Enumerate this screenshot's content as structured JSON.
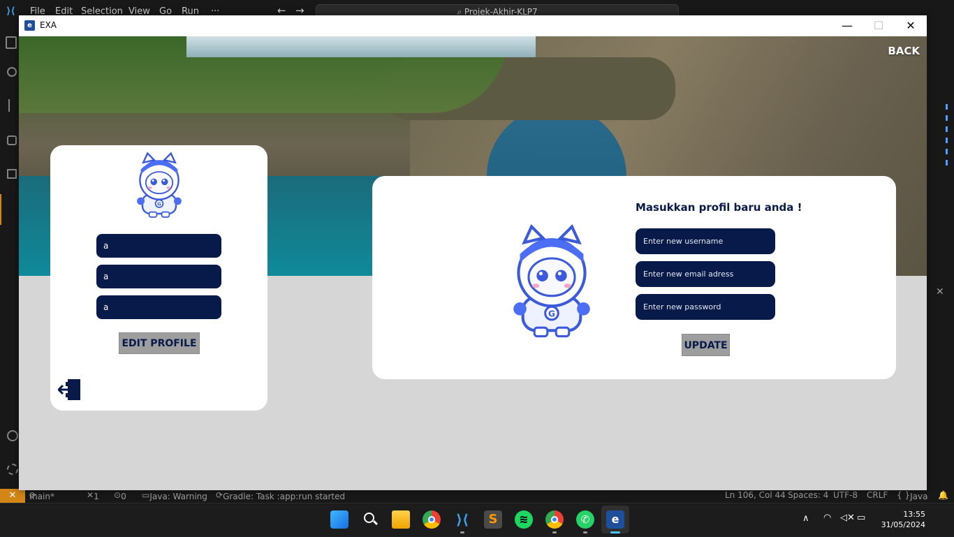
{
  "vscode": {
    "menu": [
      "File",
      "Edit",
      "Selection",
      "View",
      "Go",
      "Run",
      "···"
    ],
    "search_text": "Projek-Akhir-KLP7",
    "status": {
      "branch": "main*",
      "errors": "1",
      "ports": "0",
      "java": "Java: Warning",
      "gradle": "Gradle: Task :app:run started",
      "position": "Ln 106, Col 44",
      "spaces": "Spaces: 4",
      "encoding": "UTF-8",
      "eol": "CRLF",
      "language": "Java"
    }
  },
  "app": {
    "title": "EXA",
    "back_label": "BACK",
    "profile": {
      "username": "a",
      "email": "a",
      "password": "a",
      "edit_label": "EDIT PROFILE"
    },
    "update_form": {
      "title": "Masukkan profil baru anda !",
      "username_placeholder": "Enter new username",
      "email_placeholder": "Enter new email adress",
      "password_placeholder": "Enter new password",
      "update_label": "UPDATE"
    },
    "colors": {
      "navy": "#071a4a",
      "button_gray": "#9e9e9e",
      "content_bg": "#d6d6d6"
    }
  },
  "taskbar": {
    "apps": [
      "start",
      "search",
      "file-explorer",
      "chrome",
      "vscode",
      "sublime-text",
      "spotify",
      "chrome-alt",
      "whatsapp",
      "exa-app"
    ],
    "time": "13:55",
    "date": "31/05/2024"
  }
}
